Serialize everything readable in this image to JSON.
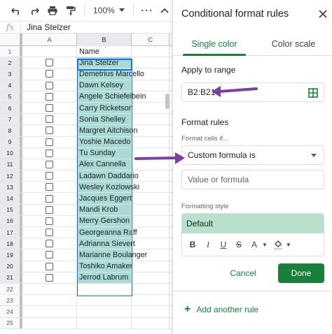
{
  "toolbar": {
    "zoom": "100%",
    "more": "⋯"
  },
  "formula_bar": {
    "fx": "fx",
    "value": "Jina Stelzer"
  },
  "grid": {
    "columns": [
      "A",
      "B",
      "C"
    ],
    "rows": [
      {
        "num": "1",
        "checkbox": false,
        "b": "Name"
      },
      {
        "num": "2",
        "checkbox": true,
        "b": "Jina Stelzer"
      },
      {
        "num": "3",
        "checkbox": true,
        "b": "Demetrius Marcello"
      },
      {
        "num": "4",
        "checkbox": true,
        "b": "Dawn Kelsey"
      },
      {
        "num": "5",
        "checkbox": true,
        "b": "Angele Schiefelbein"
      },
      {
        "num": "6",
        "checkbox": true,
        "b": "Carry Ricketson"
      },
      {
        "num": "7",
        "checkbox": true,
        "b": "Sonia Shelley"
      },
      {
        "num": "8",
        "checkbox": true,
        "b": "Margret Aitchison"
      },
      {
        "num": "9",
        "checkbox": true,
        "b": "Yoshie Macedo"
      },
      {
        "num": "10",
        "checkbox": true,
        "b": "Tu Sunday"
      },
      {
        "num": "11",
        "checkbox": true,
        "b": "Alex Cannella"
      },
      {
        "num": "12",
        "checkbox": true,
        "b": "Ladawn Daddario"
      },
      {
        "num": "13",
        "checkbox": true,
        "b": "Wesley Kozlowski"
      },
      {
        "num": "14",
        "checkbox": true,
        "b": "Jacques Eggert"
      },
      {
        "num": "15",
        "checkbox": true,
        "b": "Mandi Krob"
      },
      {
        "num": "16",
        "checkbox": true,
        "b": "Merry Gershon"
      },
      {
        "num": "17",
        "checkbox": true,
        "b": "Georgeanna Raff"
      },
      {
        "num": "18",
        "checkbox": true,
        "b": "Adrianna Sievert"
      },
      {
        "num": "19",
        "checkbox": true,
        "b": "Marianne Boulanger"
      },
      {
        "num": "20",
        "checkbox": true,
        "b": "Toshiko Amaker"
      },
      {
        "num": "21",
        "checkbox": true,
        "b": "Jerrod Labrum"
      },
      {
        "num": "22",
        "checkbox": false,
        "b": ""
      },
      {
        "num": "23",
        "checkbox": false,
        "b": ""
      },
      {
        "num": "24",
        "checkbox": false,
        "b": ""
      },
      {
        "num": "25",
        "checkbox": false,
        "b": ""
      }
    ]
  },
  "panel": {
    "title": "Conditional format rules",
    "tabs": {
      "single": "Single color",
      "scale": "Color scale"
    },
    "apply_to_range": {
      "label": "Apply to range",
      "value": "B2:B21"
    },
    "format_rules": {
      "label": "Format rules",
      "cells_if_label": "Format cells if...",
      "condition": "Custom formula is",
      "value_placeholder": "Value or formula"
    },
    "formatting_style": {
      "label": "Formatting style",
      "preset": "Default",
      "bold": "B",
      "italic": "I",
      "underline": "U",
      "strikethrough": "S",
      "text_color": "A"
    },
    "cancel": "Cancel",
    "done": "Done",
    "add_rule": "Add another rule"
  },
  "colors": {
    "accent_green": "#188038",
    "selection_fill": "#a9dbd6",
    "style_preview": "#b7e1cd",
    "annotation_arrow": "#7b3fa0",
    "selection_border": "#1a73e8"
  }
}
